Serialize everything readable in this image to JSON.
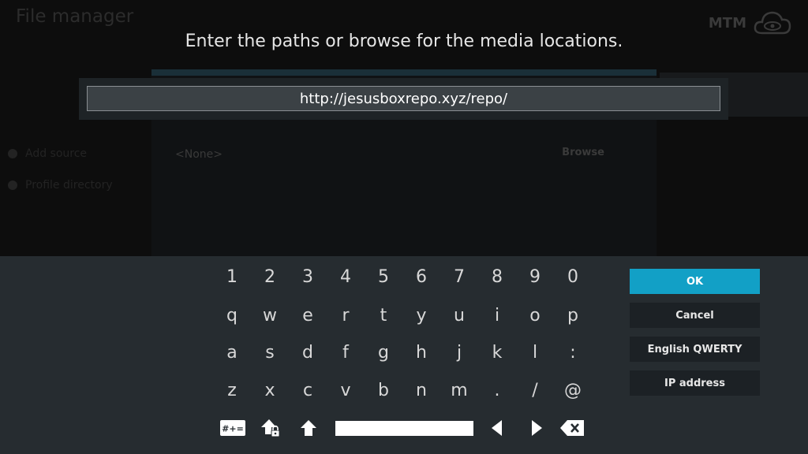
{
  "background": {
    "title": "File manager",
    "logo_text": "MTM",
    "sidebar_items": [
      "Add source",
      "Profile directory"
    ],
    "source_value": "<None>",
    "browse_label": "Browse"
  },
  "dialog": {
    "heading": "Enter the paths or browse for the media locations.",
    "path_value": "http://jesusboxrepo.xyz/repo/"
  },
  "keyboard": {
    "rows": [
      [
        "1",
        "2",
        "3",
        "4",
        "5",
        "6",
        "7",
        "8",
        "9",
        "0"
      ],
      [
        "q",
        "w",
        "e",
        "r",
        "t",
        "y",
        "u",
        "i",
        "o",
        "p"
      ],
      [
        "a",
        "s",
        "d",
        "f",
        "g",
        "h",
        "j",
        "k",
        "l",
        ":"
      ],
      [
        "z",
        "x",
        "c",
        "v",
        "b",
        "n",
        "m",
        ".",
        "/",
        "@"
      ]
    ],
    "symbols_label": "#+=",
    "buttons": {
      "ok": "OK",
      "cancel": "Cancel",
      "layout": "English QWERTY",
      "ip": "IP address"
    }
  },
  "colors": {
    "accent": "#12a0c6",
    "keyboard_bg": "#262c30",
    "input_bg": "#3b4145"
  },
  "icons": {
    "symbols": "symbols-key-icon",
    "caps_lock": "caps-lock-icon",
    "shift": "shift-icon",
    "left": "arrow-left-icon",
    "right": "arrow-right-icon",
    "backspace": "backspace-icon"
  }
}
